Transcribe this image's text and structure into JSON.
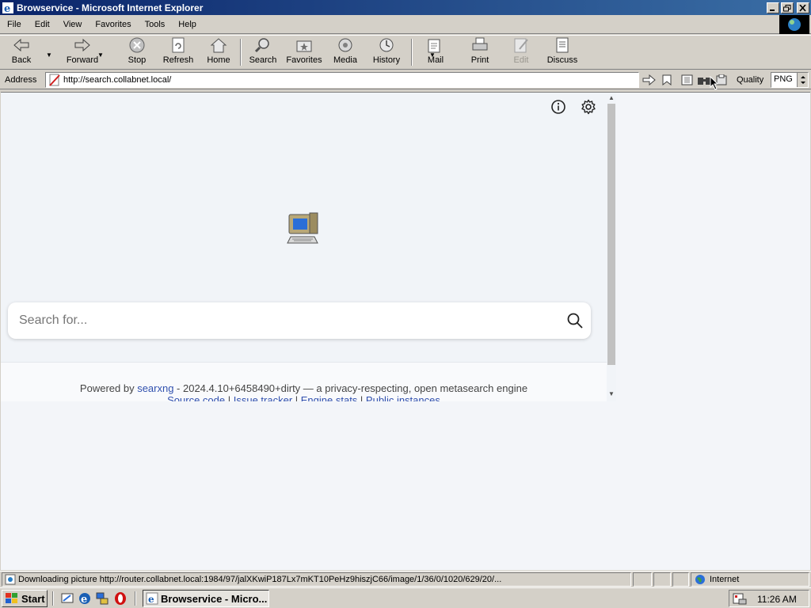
{
  "window": {
    "title": "Browservice - Microsoft Internet Explorer"
  },
  "menu": [
    {
      "label": "File"
    },
    {
      "label": "Edit"
    },
    {
      "label": "View"
    },
    {
      "label": "Favorites"
    },
    {
      "label": "Tools"
    },
    {
      "label": "Help"
    }
  ],
  "toolbar": {
    "back": "Back",
    "forward": "Forward",
    "stop": "Stop",
    "refresh": "Refresh",
    "home": "Home",
    "search": "Search",
    "favorites": "Favorites",
    "media": "Media",
    "history": "History",
    "mail": "Mail",
    "print": "Print",
    "edit": "Edit",
    "discuss": "Discuss"
  },
  "address": {
    "label": "Address",
    "url": "http://search.collabnet.local/",
    "quality_label": "Quality",
    "quality_value": "PNG"
  },
  "page": {
    "search_placeholder": "Search for...",
    "footer_powered": "Powered by ",
    "footer_link": "searxng",
    "footer_rest": " - 2024.4.10+6458490+dirty — a privacy-respecting, open metasearch engine",
    "footer_links": [
      "Source code",
      "Issue tracker",
      "Engine stats",
      "Public instances"
    ],
    "footer_sep": " | "
  },
  "status": {
    "message": "Downloading picture http://router.collabnet.local:1984/97/jalXKwiP187Lx7mKT10PeHz9hiszjC66/image/1/36/0/1020/629/20/...",
    "zone": "Internet"
  },
  "taskbar": {
    "start": "Start",
    "window_button": "Browservice - Micro...",
    "clock": "11:26 AM"
  },
  "colors": {
    "title_start": "#0a246a",
    "title_end": "#3a6ea5",
    "link": "#3050ae"
  }
}
